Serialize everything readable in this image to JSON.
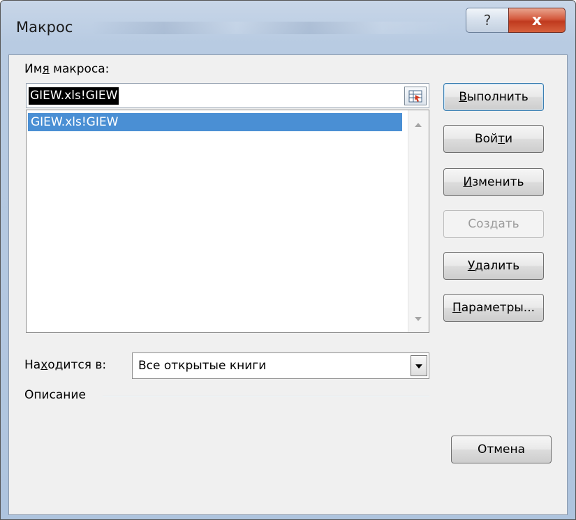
{
  "window": {
    "title": "Макрос",
    "help_glyph": "?",
    "close_glyph": "x"
  },
  "macro_name": {
    "label_pre": "Им",
    "label_ul": "я",
    "label_post": " макроса:",
    "value": "GIEW.xls!GIEW"
  },
  "macro_list": {
    "items": [
      "GIEW.xls!GIEW"
    ]
  },
  "buttons": {
    "run": {
      "ul": "В",
      "rest": "ыполнить"
    },
    "step_into": {
      "pre": "Вой",
      "ul": "т",
      "rest": "и"
    },
    "edit": {
      "ul": "И",
      "rest": "зменить"
    },
    "create": {
      "label": "Создать"
    },
    "delete": {
      "ul": "У",
      "rest": "далить"
    },
    "options": {
      "ul": "П",
      "rest": "араметры..."
    },
    "cancel": {
      "label": "Отмена"
    }
  },
  "location": {
    "label_pre": "На",
    "label_ul": "х",
    "label_post": "одится в:",
    "value": "Все открытые книги"
  },
  "description": {
    "label": "Описание"
  },
  "colors": {
    "selection": "#4a8fd4",
    "close_red": "#c03a1f"
  }
}
